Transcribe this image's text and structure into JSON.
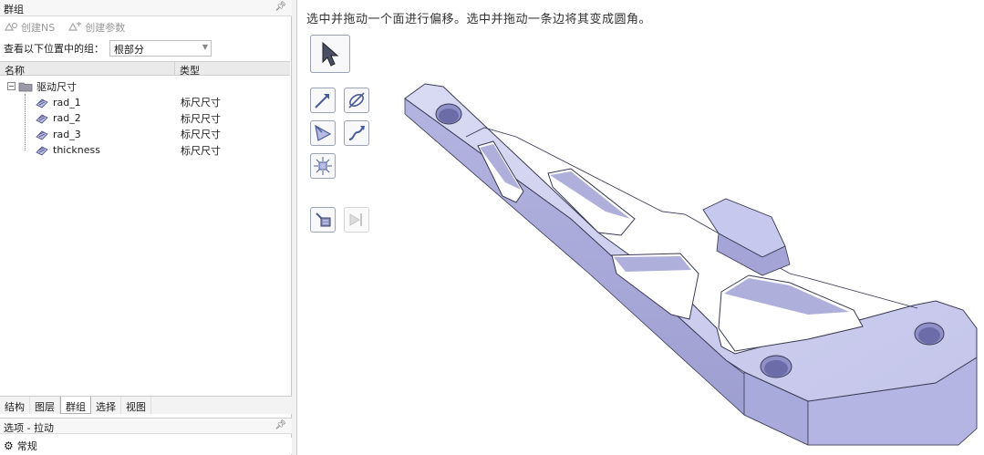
{
  "left_panel": {
    "title": "群组",
    "pin_icon": "pin-icon",
    "toolbar": {
      "create_ns_label": "创建NS",
      "create_param_label": "创建参数"
    },
    "lookup": {
      "label": "查看以下位置中的组：",
      "selected": "根部分"
    },
    "columns": {
      "name": "名称",
      "type": "类型"
    },
    "tree": {
      "root": {
        "label": "驱动尺寸",
        "expander": "−"
      },
      "children": [
        {
          "label": "rad_1",
          "type": "标尺尺寸"
        },
        {
          "label": "rad_2",
          "type": "标尺尺寸"
        },
        {
          "label": "rad_3",
          "type": "标尺尺寸"
        },
        {
          "label": "thickness",
          "type": "标尺尺寸"
        }
      ]
    },
    "tabs": [
      {
        "label": "结构",
        "active": false
      },
      {
        "label": "图层",
        "active": false
      },
      {
        "label": "群组",
        "active": true
      },
      {
        "label": "选择",
        "active": false
      },
      {
        "label": "视图",
        "active": false
      }
    ],
    "options": {
      "title": "选项 - 拉动",
      "item": "常规"
    }
  },
  "viewport": {
    "hint": "选中并拖动一个面进行偏移。选中并拖动一条边将其变成圆角。",
    "tools": [
      {
        "name": "select-tool",
        "icon": "cursor-arrow-icon"
      },
      {
        "name": "direction-tool",
        "icon": "arrow-direction-icon"
      },
      {
        "name": "revolve-tool",
        "icon": "revolve-icon"
      },
      {
        "name": "draft-tool",
        "icon": "draft-icon"
      },
      {
        "name": "sweep-tool",
        "icon": "sweep-icon"
      },
      {
        "name": "scale-tool",
        "icon": "scale-icon"
      },
      {
        "name": "ruler-tool",
        "icon": "ruler-icon"
      },
      {
        "name": "up-to-tool",
        "icon": "up-to-icon"
      }
    ],
    "colors": {
      "model_top": "#cfd0ef",
      "model_side": "#a9aadc",
      "model_dark": "#8f90c8",
      "model_edge": "#3a3a55",
      "accent": "#4a5b9a"
    }
  }
}
